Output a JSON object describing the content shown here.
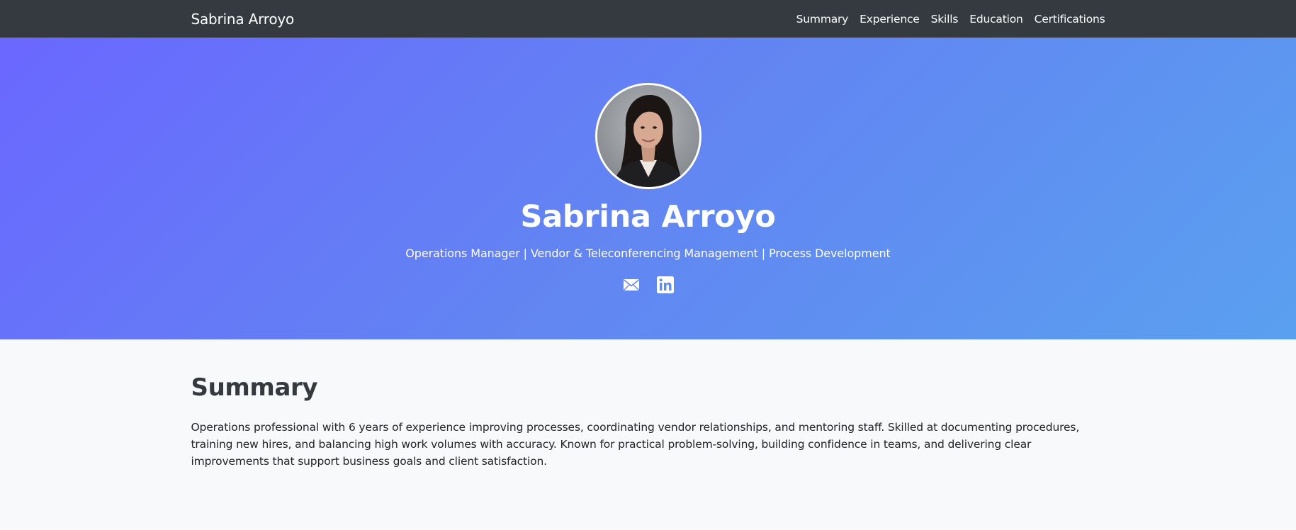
{
  "nav": {
    "brand": "Sabrina Arroyo",
    "links": [
      "Summary",
      "Experience",
      "Skills",
      "Education",
      "Certifications"
    ]
  },
  "hero": {
    "photo_alt": "Sabrina Arroyo",
    "name": "Sabrina Arroyo",
    "tagline": "Operations Manager | Vendor & Teleconferencing Management | Process Development",
    "social": [
      "mail-icon",
      "linkedin-icon"
    ]
  },
  "summary": {
    "heading": "Summary",
    "text": "Operations professional with 6 years of experience improving processes, coordinating vendor relationships, and mentoring staff. Skilled at documenting procedures, training new hires, and balancing high work volumes with accuracy. Known for practical problem-solving, building confidence in teams, and delivering clear improvements that support business goals and client satisfaction."
  },
  "colors": {
    "navbar": "#343a40",
    "hero_gradient_start": "#6a67ff",
    "hero_gradient_end": "#5aa0f0",
    "page_bg": "#f8f9fa",
    "heading": "#343a40"
  }
}
